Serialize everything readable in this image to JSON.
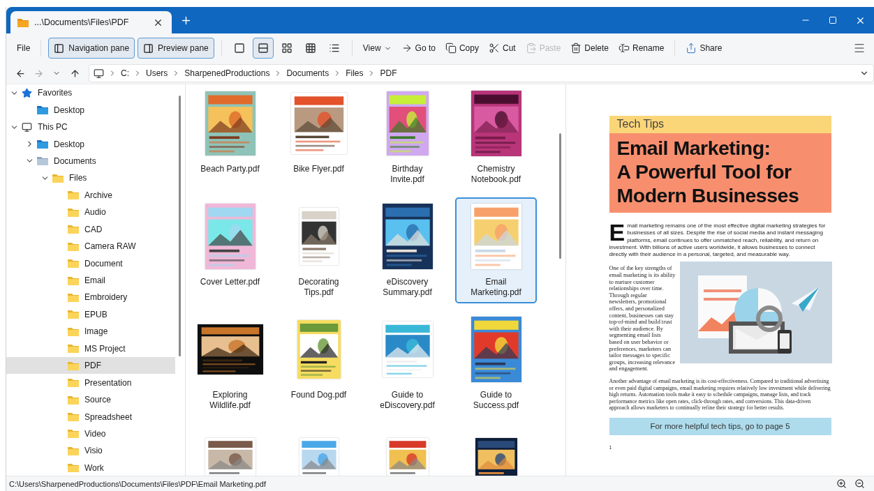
{
  "window": {
    "tab_title": "...\\Documents\\Files\\PDF"
  },
  "toolbar": {
    "file": "File",
    "panes": [
      {
        "label": "Navigation pane",
        "selected": true
      },
      {
        "label": "Preview pane",
        "selected": true
      }
    ],
    "layouts": [
      {
        "selected": false
      },
      {
        "selected": true
      },
      {
        "selected": false
      },
      {
        "selected": false
      },
      {
        "selected": false
      }
    ],
    "view": "View",
    "commands": [
      {
        "label": "Go to",
        "disabled": false
      },
      {
        "label": "Copy",
        "disabled": false
      },
      {
        "label": "Cut",
        "disabled": false
      },
      {
        "label": "Paste",
        "disabled": true
      },
      {
        "label": "Delete",
        "disabled": false
      },
      {
        "label": "Rename",
        "disabled": false
      }
    ],
    "share": "Share"
  },
  "address": {
    "crumbs": [
      "C:",
      "Users",
      "SharpenedProductions",
      "Documents",
      "Files",
      "PDF"
    ]
  },
  "sidebar": {
    "tree": [
      {
        "label": "Favorites",
        "kind": "favorites",
        "expanded": true,
        "selected": false,
        "children": [
          {
            "label": "Desktop",
            "kind": "desktop",
            "selected": false
          }
        ]
      },
      {
        "label": "This PC",
        "kind": "computer",
        "expanded": true,
        "selected": false,
        "children": [
          {
            "label": "Desktop",
            "kind": "desktop",
            "expanded": false,
            "selected": false
          },
          {
            "label": "Documents",
            "kind": "documents",
            "expanded": true,
            "selected": false,
            "children": [
              {
                "label": "Files",
                "kind": "folder",
                "expanded": true,
                "selected": false,
                "children": [
                  {
                    "label": "Archive",
                    "kind": "folder",
                    "selected": false
                  },
                  {
                    "label": "Audio",
                    "kind": "folder",
                    "selected": false
                  },
                  {
                    "label": "CAD",
                    "kind": "folder",
                    "selected": false
                  },
                  {
                    "label": "Camera RAW",
                    "kind": "folder",
                    "selected": false
                  },
                  {
                    "label": "Document",
                    "kind": "folder",
                    "selected": false
                  },
                  {
                    "label": "Email",
                    "kind": "folder",
                    "selected": false
                  },
                  {
                    "label": "Embroidery",
                    "kind": "folder",
                    "selected": false
                  },
                  {
                    "label": "EPUB",
                    "kind": "folder",
                    "selected": false
                  },
                  {
                    "label": "Image",
                    "kind": "folder",
                    "selected": false
                  },
                  {
                    "label": "MS Project",
                    "kind": "folder",
                    "selected": false
                  },
                  {
                    "label": "PDF",
                    "kind": "folder",
                    "selected": true
                  },
                  {
                    "label": "Presentation",
                    "kind": "folder",
                    "selected": false
                  },
                  {
                    "label": "Source",
                    "kind": "folder",
                    "selected": false
                  },
                  {
                    "label": "Spreadsheet",
                    "kind": "folder",
                    "selected": false
                  },
                  {
                    "label": "Video",
                    "kind": "folder",
                    "selected": false
                  },
                  {
                    "label": "Visio",
                    "kind": "folder",
                    "selected": false
                  },
                  {
                    "label": "Work",
                    "kind": "folder",
                    "selected": false
                  }
                ]
              }
            ]
          }
        ]
      }
    ]
  },
  "files": [
    {
      "name": "Beach Party.pdf",
      "selected": false
    },
    {
      "name": "Bike Flyer.pdf",
      "selected": false
    },
    {
      "name": "Birthday Invite.pdf",
      "selected": false
    },
    {
      "name": "Chemistry Notebook.pdf",
      "selected": false
    },
    {
      "name": "Cover Letter.pdf",
      "selected": false
    },
    {
      "name": "Decorating Tips.pdf",
      "selected": false
    },
    {
      "name": "eDiscovery Summary.pdf",
      "selected": false
    },
    {
      "name": "Email Marketing.pdf",
      "selected": true
    },
    {
      "name": "Exploring Wildlife.pdf",
      "selected": false
    },
    {
      "name": "Found Dog.pdf",
      "selected": false
    },
    {
      "name": "Guide to eDiscovery.pdf",
      "selected": false
    },
    {
      "name": "Guide to Success.pdf",
      "selected": false
    },
    {
      "selected": false
    },
    {
      "selected": false
    },
    {
      "selected": false
    },
    {
      "selected": false
    }
  ],
  "preview": {
    "section": "Tech Tips",
    "headline": "Email Marketing:\nA Powerful Tool for\nModern Businesses",
    "intro": "Email marketing remains one of the most effective digital marketing strategies for businesses of all sizes. Despite the rise of social media and instant messaging platforms, email continues to offer unmatched reach, reliability, and return on investment. With billions of active users worldwide, it allows businesses to connect directly with their audience in a personal, targeted, and measurable way.",
    "column_text": "One of the key strengths of email marketing is its ability to nurture customer relationships over time. Through regular newsletters, promotional offers, and personalized content, businesses can stay top-of-mind and build trust with their audience. By segmenting email lists based on user behavior or preferences, marketers can tailor messages to specific groups, increasing relevance and engagement.",
    "closing": "Another advantage of email marketing is its cost-effectiveness. Compared to traditional advertising or even paid digital campaigns, email marketing requires relatively low investment while delivering high returns. Automation tools make it easy to schedule campaigns, manage lists, and track performance metrics like open rates, click-through rates, and conversions. This data-driven approach allows marketers to continually refine their strategy for better results.",
    "callout": "For more helpful tech tips, go to page 5",
    "page_number": "1"
  },
  "status_bar": {
    "path": "C:\\Users\\SharpenedProductions\\Documents\\Files\\PDF\\Email Marketing.pdf"
  }
}
